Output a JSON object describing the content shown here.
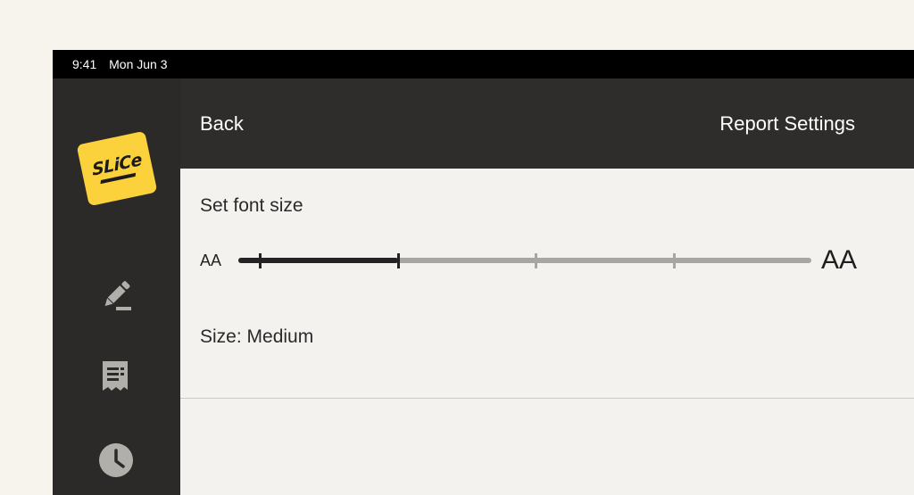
{
  "status_bar": {
    "time": "9:41",
    "date": "Mon Jun 3"
  },
  "sidebar": {
    "logo_text": "SLiCe",
    "items": [
      {
        "icon": "pencil-icon"
      },
      {
        "icon": "receipt-icon"
      },
      {
        "icon": "clock-icon"
      }
    ]
  },
  "header": {
    "back_label": "Back",
    "title": "Report Settings"
  },
  "font_size": {
    "label": "Set font size",
    "small_label": "AA",
    "large_label": "AA",
    "slider": {
      "steps": 5,
      "selected_index": 1
    },
    "readout": "Size: Medium"
  },
  "colors": {
    "brand_yellow": "#fbd23c",
    "sidebar_bg": "#2b2a29",
    "header_bg": "#2e2d2c",
    "slider_active": "#232323",
    "slider_inactive": "#a7a6a3"
  }
}
